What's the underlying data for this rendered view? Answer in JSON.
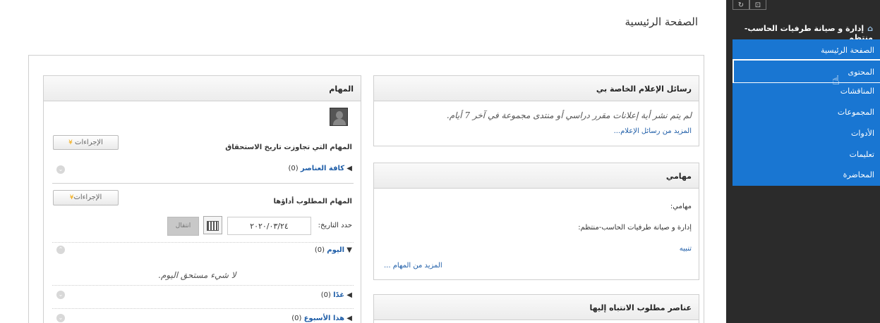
{
  "sidebar": {
    "top_icons": [
      "↻",
      "⊡"
    ],
    "course_title": "إدارة و صيانة طرفيات الحاسب-منتظم",
    "items": [
      {
        "label": "الصفحة الرئيسية"
      },
      {
        "label": "المحتوى"
      },
      {
        "label": "المناقشات"
      },
      {
        "label": "المجموعات"
      },
      {
        "label": "الأدوات"
      },
      {
        "label": "تعليمات"
      },
      {
        "label": "المحاضرة"
      }
    ]
  },
  "page": {
    "title": "الصفحة الرئيسية"
  },
  "announcements": {
    "header": "رسائل الإعلام الخاصة بي",
    "empty_text": "لم يتم نشر أية إعلانات مقرر دراسي أو منتدى مجموعة في آخر 7 أيام.",
    "more_link": "المزيد من رسائل الإعلام..."
  },
  "my_tasks": {
    "header": "مهامي",
    "label": "مهامي:",
    "course": "إدارة و صيانة طرفيات الحاسب-منتظم:",
    "notice_link": "تنبيه",
    "more_link": "المزيد من المهام ..."
  },
  "attention": {
    "header": "عناصر مطلوب الانتباه إليها"
  },
  "tasks": {
    "header": "المهام",
    "overdue_title": "المهام التي تجاوزت تاريخ الاستحقاق",
    "actions_label": "الإجراءات",
    "all_items_label": "كافة العناصر",
    "all_items_count": "(0)",
    "due_title": "المهام المطلوب أداؤها",
    "due_date_label": "حدد التاريخ:",
    "due_date_value": "٢٠٢٠/٠٣/٢٤",
    "go_label": "انتقال",
    "today_label": "اليوم",
    "today_count": "(0)",
    "today_empty": "لا شيء مستحق اليوم.",
    "tomorrow_label": "غدًا",
    "tomorrow_count": "(0)",
    "week_label": "هذا الأسبوع",
    "week_count": "(0)"
  }
}
